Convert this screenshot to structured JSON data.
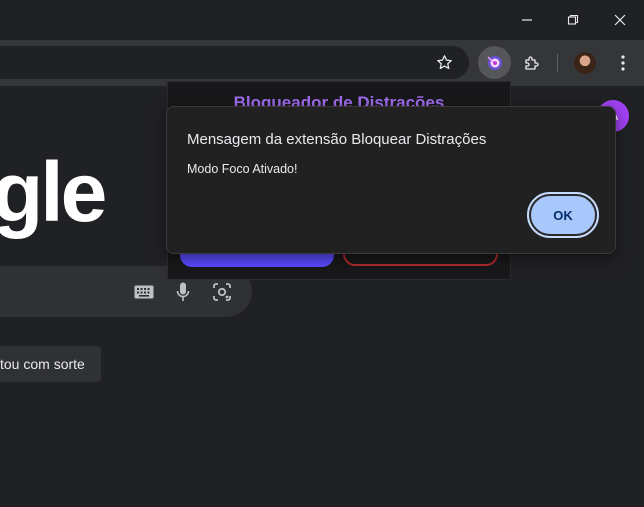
{
  "browser": {
    "window_controls": {
      "minimize_icon": "minimize-icon",
      "restore_icon": "restore-icon",
      "close_icon": "close-icon"
    },
    "toolbar": {
      "bookmark_icon": "star-icon",
      "extension_active_icon": "extension-target-icon",
      "extensions_icon": "puzzle-icon",
      "profile_icon": "profile-avatar",
      "menu_icon": "kebab-menu-icon"
    }
  },
  "google_page": {
    "logo_text": "gle",
    "lucky_button_label": "tou com sorte",
    "account_initial": "A",
    "search_icons": [
      "keyboard-icon",
      "microphone-icon",
      "lens-icon"
    ]
  },
  "extension_popup": {
    "title": "Bloqueador de Distrações",
    "colors": {
      "title": "#a06cf0",
      "primary_button": "#5b4bff",
      "secondary_border": "#b12b2b"
    }
  },
  "alert_dialog": {
    "title": "Mensagem da extensão Bloquear Distrações",
    "message": "Modo Foco Ativado!",
    "ok_label": "OK",
    "colors": {
      "ok_background": "#a8c7fa",
      "ok_text": "#062e6f"
    }
  }
}
